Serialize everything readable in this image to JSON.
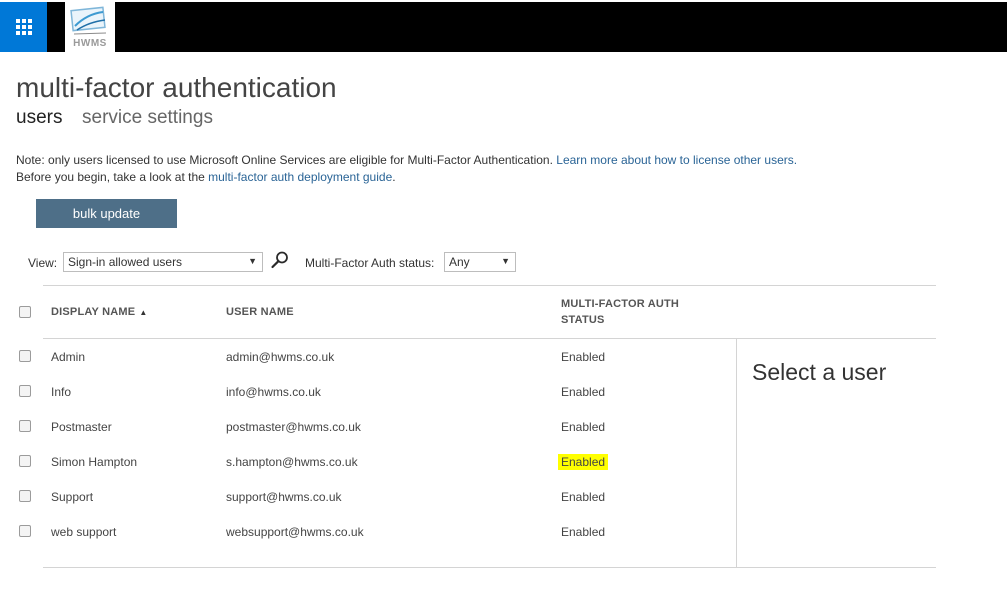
{
  "header": {
    "logo_text": "HWMS",
    "colors": {
      "waffle_bg": "#0078d7",
      "bar_bg": "#000000"
    }
  },
  "page": {
    "title": "multi-factor authentication",
    "tabs": [
      {
        "label": "users",
        "active": true
      },
      {
        "label": "service settings",
        "active": false
      }
    ]
  },
  "notes": {
    "line1_text": "Note: only users licensed to use Microsoft Online Services are eligible for Multi-Factor Authentication.",
    "line1_link": "Learn more about how to license other users.",
    "line2_text": "Before you begin, take a look at the",
    "line2_link": "multi-factor auth deployment guide",
    "line2_end": "."
  },
  "toolbar": {
    "bulk_update_label": "bulk update",
    "view_label": "View:",
    "view_value": "Sign-in allowed users",
    "mfa_status_label": "Multi-Factor Auth status:",
    "mfa_status_value": "Any",
    "search_icon": "search-icon",
    "accent_button_color": "#4e6f88"
  },
  "table": {
    "columns": {
      "display_name": "DISPLAY NAME",
      "user_name": "USER NAME",
      "mfa_status_line1": "MULTI-FACTOR AUTH",
      "mfa_status_line2": "STATUS"
    },
    "sort_icon": "sort-up-triangle",
    "rows": [
      {
        "display_name": "Admin",
        "user_name": "admin@hwms.co.uk",
        "status": "Enabled",
        "highlighted": false
      },
      {
        "display_name": "Info",
        "user_name": "info@hwms.co.uk",
        "status": "Enabled",
        "highlighted": false
      },
      {
        "display_name": "Postmaster",
        "user_name": "postmaster@hwms.co.uk",
        "status": "Enabled",
        "highlighted": false
      },
      {
        "display_name": "Simon Hampton",
        "user_name": "s.hampton@hwms.co.uk",
        "status": "Enabled",
        "highlighted": true
      },
      {
        "display_name": "Support",
        "user_name": "support@hwms.co.uk",
        "status": "Enabled",
        "highlighted": false
      },
      {
        "display_name": "web support",
        "user_name": "websupport@hwms.co.uk",
        "status": "Enabled",
        "highlighted": false
      }
    ],
    "highlight_color": "#ffff00"
  },
  "side_panel": {
    "title": "Select a user"
  }
}
